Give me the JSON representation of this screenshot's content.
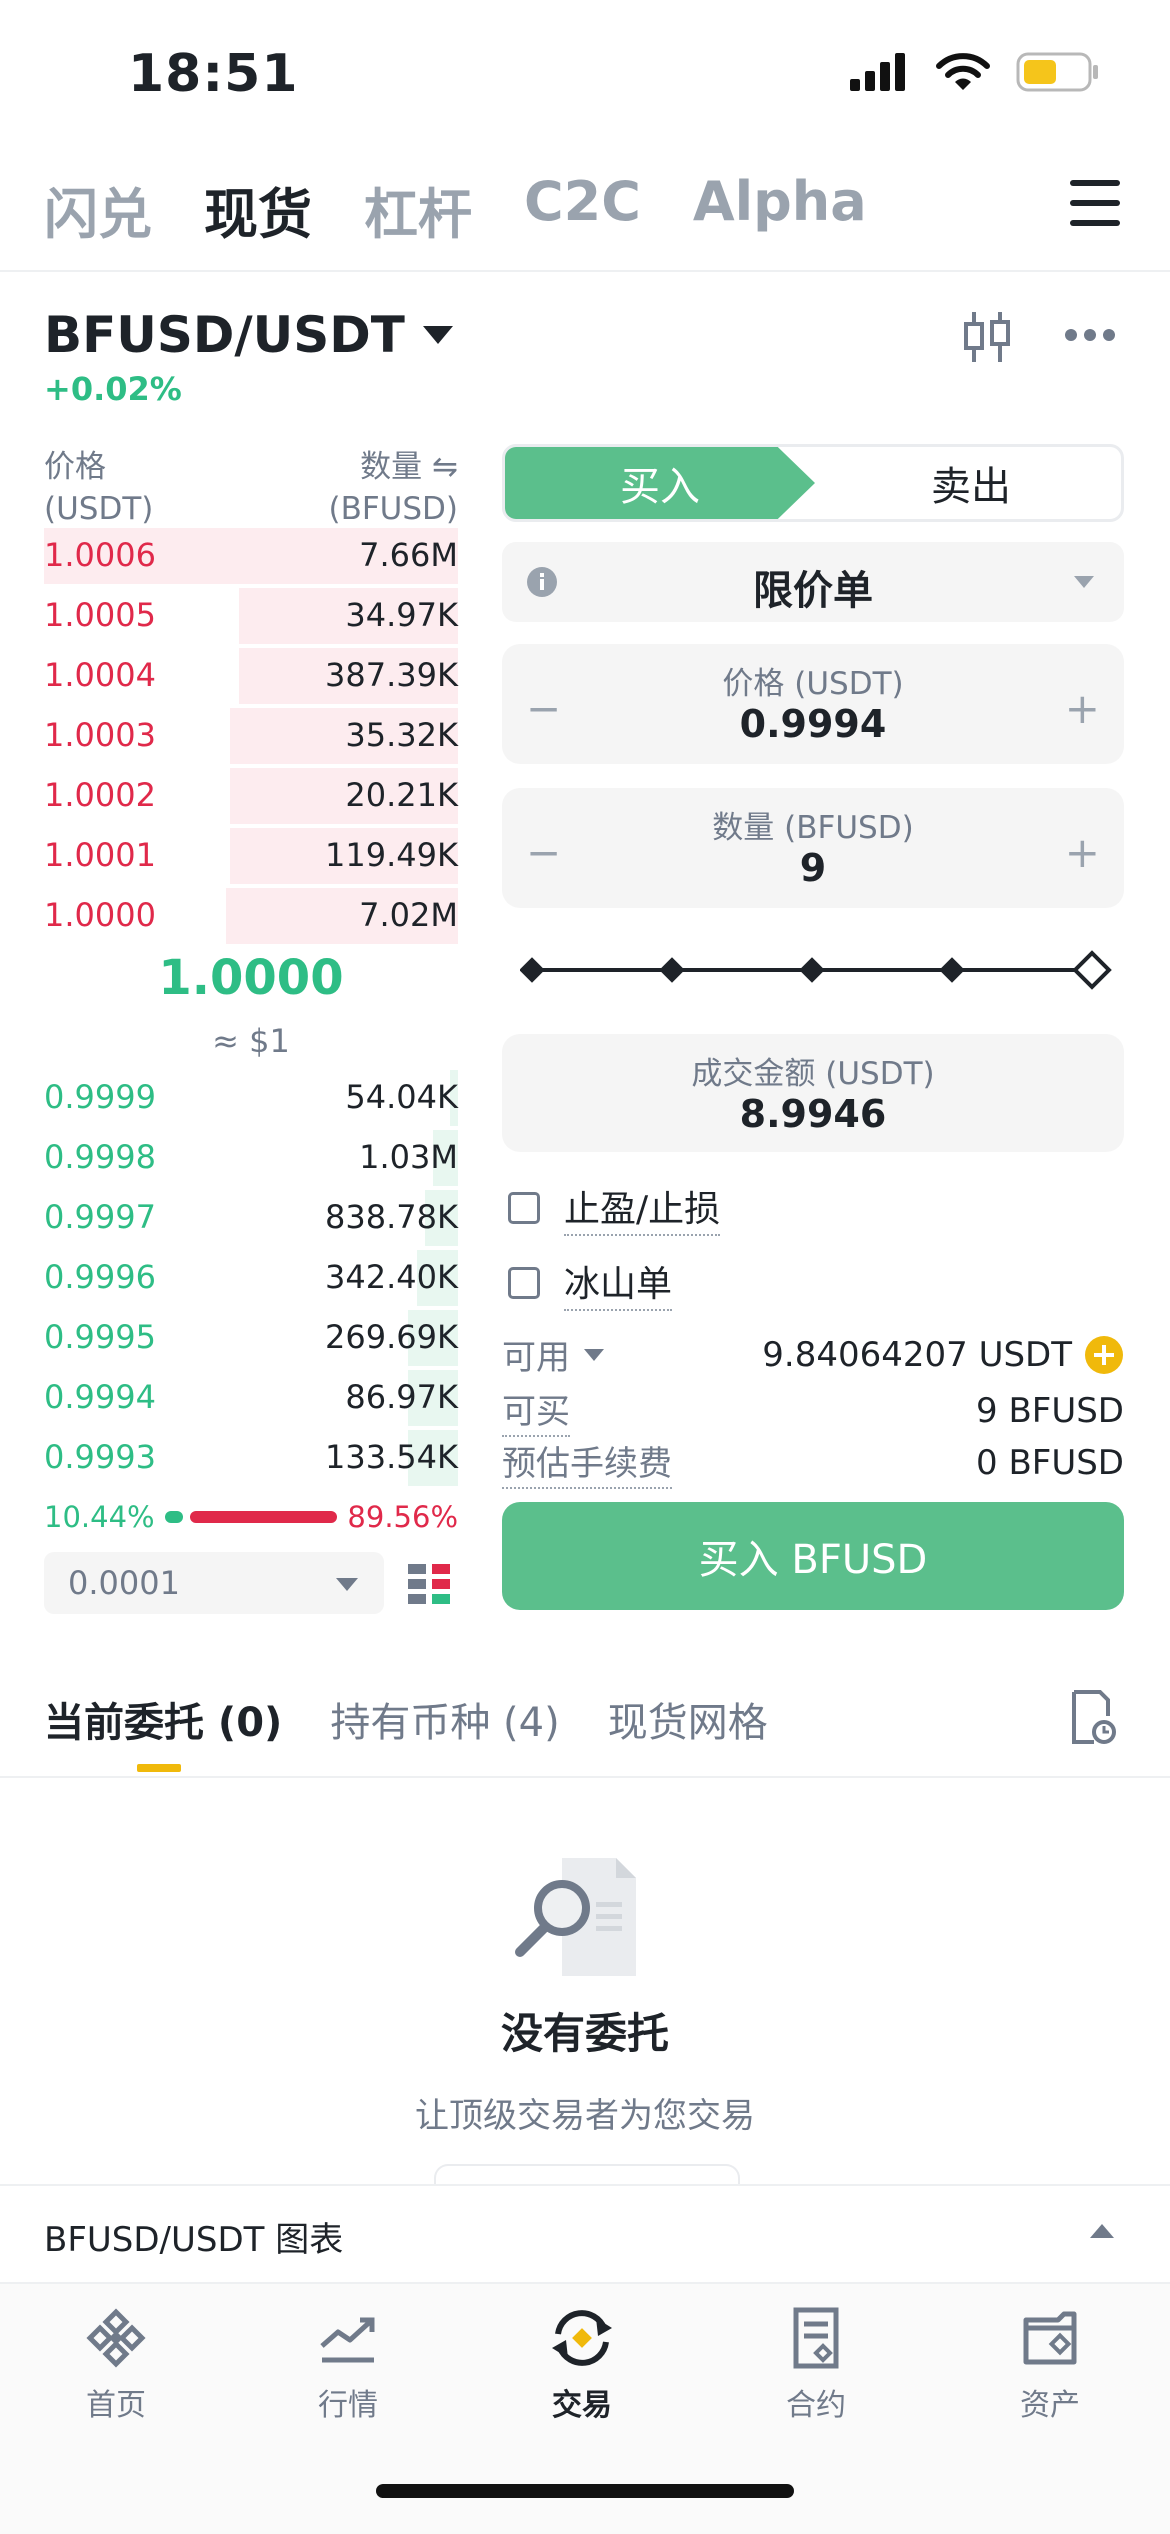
{
  "status_bar": {
    "time": "18:51"
  },
  "top_nav": {
    "tabs": [
      "闪兑",
      "现货",
      "杠杆",
      "C2C",
      "Alpha"
    ],
    "active": "现货"
  },
  "pair": {
    "symbol": "BFUSD/USDT",
    "change": "+0.02%"
  },
  "order_book": {
    "price_header": "价格",
    "price_unit": "(USDT)",
    "qty_header": "数量 ⇋",
    "qty_unit": "(BFUSD)",
    "asks": [
      {
        "price": "1.0006",
        "qty": "7.66M",
        "depth": 0.0
      },
      {
        "price": "1.0005",
        "qty": "34.97K",
        "depth": 0.47
      },
      {
        "price": "1.0004",
        "qty": "387.39K",
        "depth": 0.47
      },
      {
        "price": "1.0003",
        "qty": "35.32K",
        "depth": 0.45
      },
      {
        "price": "1.0002",
        "qty": "20.21K",
        "depth": 0.45
      },
      {
        "price": "1.0001",
        "qty": "119.49K",
        "depth": 0.45
      },
      {
        "price": "1.0000",
        "qty": "7.02M",
        "depth": 0.44
      }
    ],
    "mid_price": "1.0000",
    "mid_usd": "≈ $1",
    "bids": [
      {
        "price": "0.9999",
        "qty": "54.04K",
        "depth": 0.02
      },
      {
        "price": "0.9998",
        "qty": "1.03M",
        "depth": 0.06
      },
      {
        "price": "0.9997",
        "qty": "838.78K",
        "depth": 0.08
      },
      {
        "price": "0.9996",
        "qty": "342.40K",
        "depth": 0.1
      },
      {
        "price": "0.9995",
        "qty": "269.69K",
        "depth": 0.12
      },
      {
        "price": "0.9994",
        "qty": "86.97K",
        "depth": 0.12
      },
      {
        "price": "0.9993",
        "qty": "133.54K",
        "depth": 0.12
      }
    ],
    "buy_ratio": "10.44%",
    "sell_ratio": "89.56%",
    "buy_ratio_value": 0.1044,
    "tick_size": "0.0001"
  },
  "trade_form": {
    "buy_label": "买入",
    "sell_label": "卖出",
    "order_type": "限价单",
    "price_label": "价格 (USDT)",
    "price_value": "0.9994",
    "qty_label": "数量 (BFUSD)",
    "qty_value": "9",
    "total_label": "成交金额 (USDT)",
    "total_value": "8.9946",
    "tpsl_label": "止盈/止损",
    "iceberg_label": "冰山单",
    "available_label": "可用",
    "available_value": "9.84064207 USDT",
    "can_buy_label": "可买",
    "can_buy_value": "9 BFUSD",
    "fee_label": "预估手续费",
    "fee_value": "0 BFUSD",
    "submit_label": "买入 BFUSD",
    "minus": "−",
    "plus": "+"
  },
  "orders": {
    "tabs": [
      "当前委托 (0)",
      "持有币种 (4)",
      "现货网格"
    ],
    "empty_title": "没有委托",
    "empty_sub": "让顶级交易者为您交易"
  },
  "chart_toggle": {
    "label": "BFUSD/USDT 图表"
  },
  "bottom_nav": {
    "items": [
      {
        "label": "首页",
        "icon": "home-diamond-icon"
      },
      {
        "label": "行情",
        "icon": "market-chart-icon"
      },
      {
        "label": "交易",
        "icon": "trade-exchange-icon"
      },
      {
        "label": "合约",
        "icon": "futures-document-icon"
      },
      {
        "label": "资产",
        "icon": "wallet-icon"
      }
    ],
    "active": "交易"
  },
  "colors": {
    "green": "#2ebd85",
    "red": "#e0294a",
    "accent_yellow": "#f0b90b",
    "button_green": "#5bbf8c"
  }
}
